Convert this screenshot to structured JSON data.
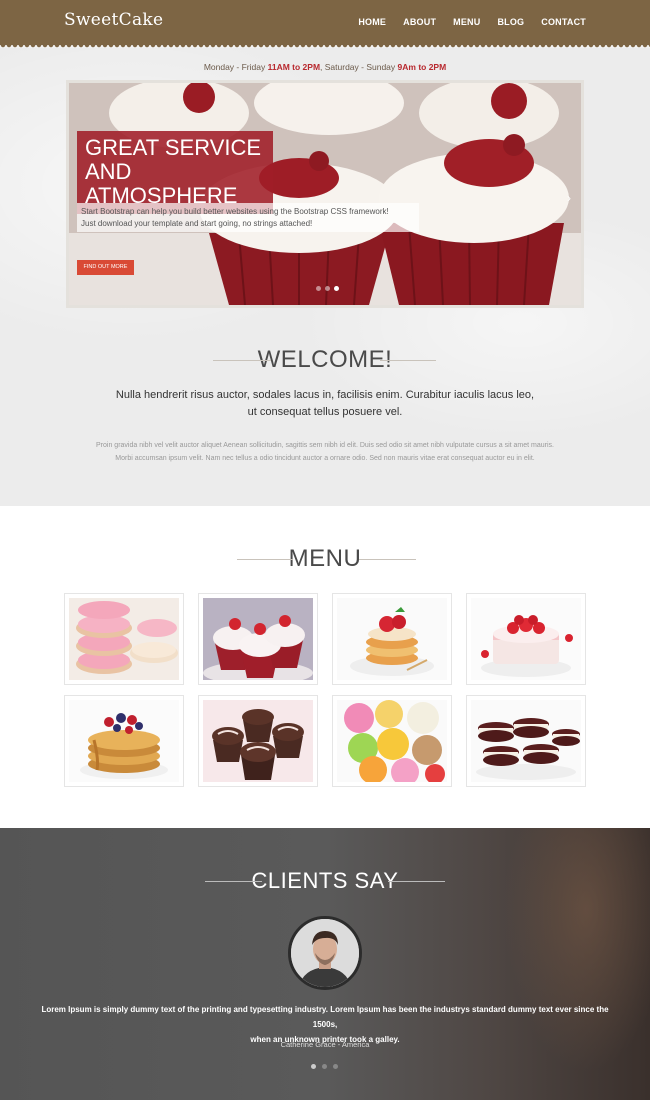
{
  "nav": {
    "logo": "SweetCake",
    "items": [
      {
        "label": "HOME"
      },
      {
        "label": "ABOUT"
      },
      {
        "label": "MENU"
      },
      {
        "label": "BLOG"
      },
      {
        "label": "CONTACT"
      }
    ]
  },
  "hours": {
    "weekday_prefix": "Monday - Friday ",
    "weekday_time": "11AM to 2PM",
    "weekend_prefix": ", Saturday - Sunday ",
    "weekend_time": "9Am to 2PM"
  },
  "slider": {
    "title_line1": "GREAT SERVICE AND",
    "title_line2": "ATMOSPHERE",
    "text_line1": "Start Bootstrap can help you build better websites using the Bootstrap CSS framework!",
    "text_line2": "Just download your template and start going, no strings attached!",
    "button_label": "FIND OUT MORE",
    "slide_count": 3,
    "active_slide": 3
  },
  "welcome": {
    "title": "WELCOME!",
    "lead_line1": "Nulla hendrerit risus auctor, sodales lacus in, facilisis enim. Curabitur iaculis lacus leo,",
    "lead_line2": "ut consequat tellus posuere vel.",
    "body_line1": "Proin gravida nibh vel velit auctor aliquet Aenean sollicitudin, sagittis sem nibh id elit. Duis sed odio sit amet nibh vulputate cursus a sit amet mauris.",
    "body_line2": "Morbi accumsan ipsum velit. Nam nec tellus a odio tincidunt auctor a ornare odio. Sed non mauris vitae erat consequat auctor eu in elit."
  },
  "menu": {
    "title": "MENU",
    "items": [
      {
        "icon": "donuts-image"
      },
      {
        "icon": "cupcakes-image"
      },
      {
        "icon": "pancake-stack-image"
      },
      {
        "icon": "strawberry-cake-image"
      },
      {
        "icon": "pancakes-berries-image"
      },
      {
        "icon": "chocolate-cupcakes-image"
      },
      {
        "icon": "ice-cream-image"
      },
      {
        "icon": "whoopie-pies-image"
      }
    ]
  },
  "clients": {
    "title": "CLIENTS SAY",
    "quote_line1": "Lorem Ipsum is simply dummy text of the printing and typesetting industry. Lorem Ipsum has been the industrys standard dummy text ever since the 1500s,",
    "quote_line2": "when an unknown printer took a galley.",
    "author": "Catherine Grace - America",
    "slide_count": 3,
    "active_slide": 1
  },
  "colors": {
    "nav_bg": "#7d6544",
    "accent_red": "#b8282e",
    "button": "#d94a35"
  }
}
